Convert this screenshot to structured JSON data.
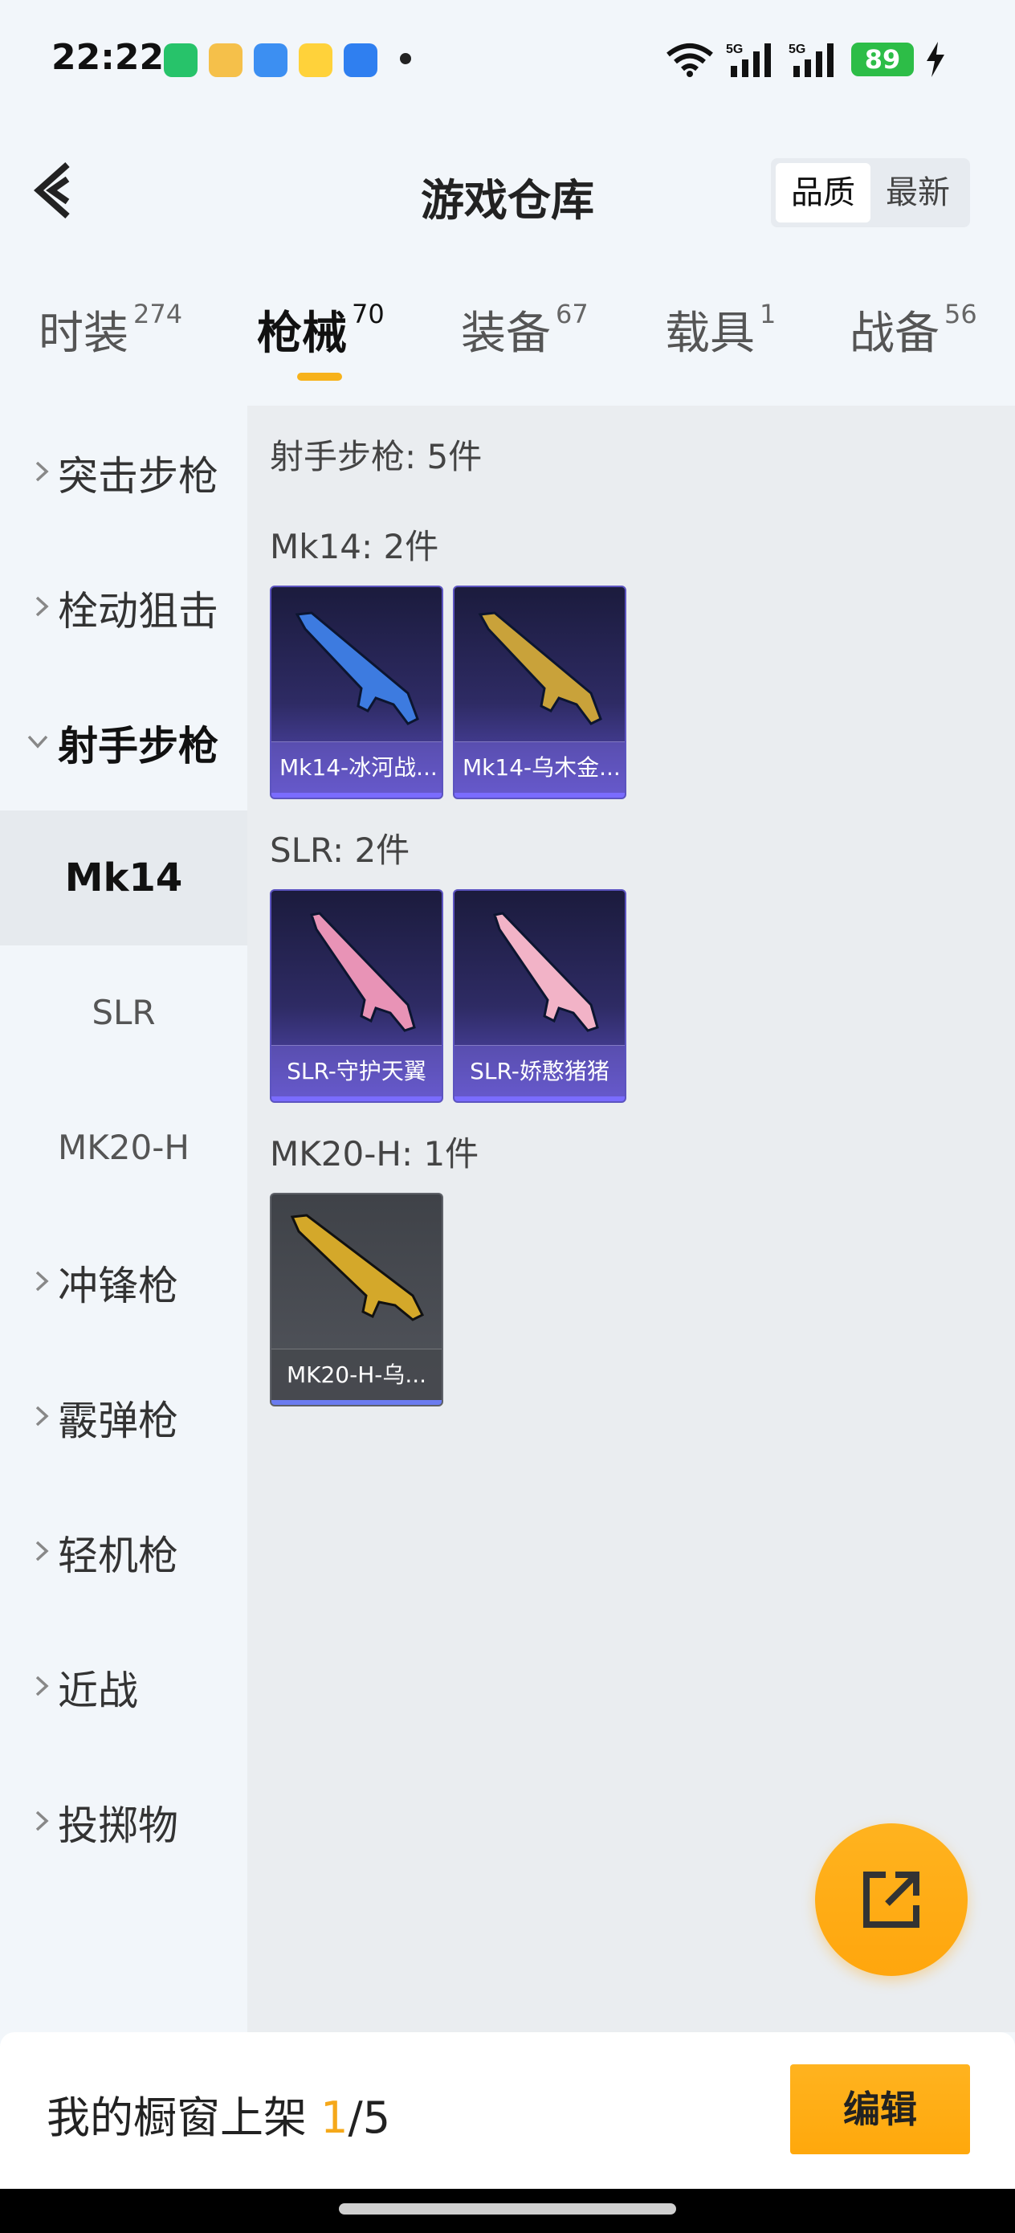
{
  "status_bar": {
    "time": "22:22",
    "battery": "89",
    "signal_label": "5G",
    "icons": [
      "battery-app-icon",
      "game-app-icon",
      "weather-icon",
      "market-app-icon",
      "files-icon"
    ]
  },
  "header": {
    "title": "游戏仓库",
    "sort_options": [
      "品质",
      "最新"
    ],
    "sort_active": "品质"
  },
  "tabs": [
    {
      "label": "时装",
      "count": "274"
    },
    {
      "label": "枪械",
      "count": "70",
      "active": true
    },
    {
      "label": "装备",
      "count": "67"
    },
    {
      "label": "载具",
      "count": "1"
    },
    {
      "label": "战备",
      "count": "56"
    }
  ],
  "sidebar": {
    "categories": [
      {
        "label": "突击步枪"
      },
      {
        "label": "栓动狙击"
      },
      {
        "label": "射手步枪",
        "open": true
      },
      {
        "label": "冲锋枪"
      },
      {
        "label": "霰弹枪"
      },
      {
        "label": "轻机枪"
      },
      {
        "label": "近战"
      },
      {
        "label": "投掷物"
      }
    ],
    "subitems": [
      "Mk14",
      "SLR",
      "MK20-H"
    ],
    "active_subitem": "Mk14"
  },
  "content": {
    "category_summary": "射手步枪: 5件",
    "groups": [
      {
        "title": "Mk14: 2件",
        "items": [
          {
            "name": "Mk14-冰河战...",
            "style": "purple",
            "art_color": "#3d7be0"
          },
          {
            "name": "Mk14-乌木金...",
            "style": "purple",
            "art_color": "#c9a23a"
          }
        ]
      },
      {
        "title": "SLR: 2件",
        "items": [
          {
            "name": "SLR-守护天翼",
            "style": "purple",
            "art_color": "#e893b6"
          },
          {
            "name": "SLR-娇憨猪猪",
            "style": "purple",
            "art_color": "#f2b3c7"
          }
        ]
      },
      {
        "title": "MK20-H: 1件",
        "items": [
          {
            "name": "MK20-H-乌...",
            "style": "gray",
            "art_color": "#d4a82a"
          }
        ]
      }
    ]
  },
  "bottom": {
    "prefix": "我的橱窗上架 ",
    "current": "1",
    "total_text": "/5",
    "edit_label": "编辑"
  },
  "colors": {
    "accent": "#f7b21b",
    "card_purple": "#2e2b64",
    "card_gray": "#52555c"
  }
}
